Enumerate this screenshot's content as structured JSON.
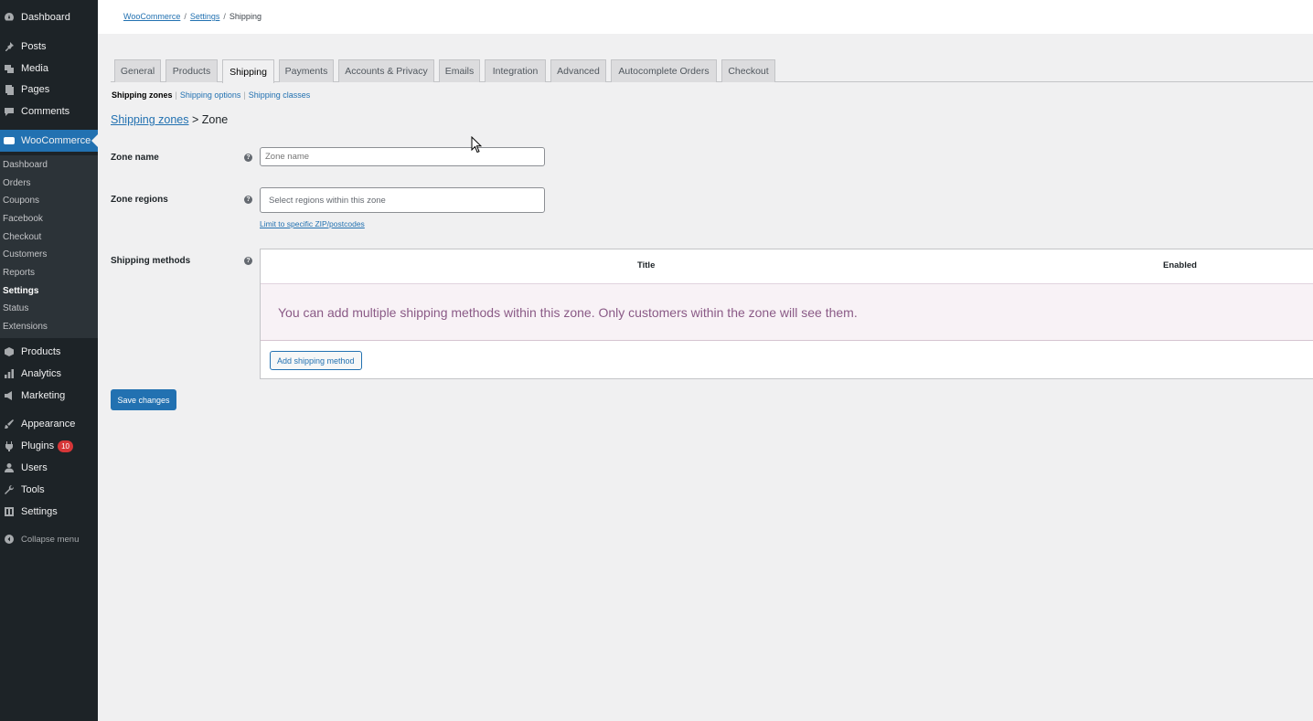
{
  "sidebar": {
    "items": [
      {
        "label": "Dashboard",
        "icon": "dashboard-icon"
      },
      {
        "label": "Posts",
        "icon": "pin-icon"
      },
      {
        "label": "Media",
        "icon": "media-icon"
      },
      {
        "label": "Pages",
        "icon": "pages-icon"
      },
      {
        "label": "Comments",
        "icon": "comment-icon"
      },
      {
        "label": "WooCommerce",
        "icon": "woo-icon"
      },
      {
        "label": "Products",
        "icon": "box-icon"
      },
      {
        "label": "Analytics",
        "icon": "bar-chart-icon"
      },
      {
        "label": "Marketing",
        "icon": "megaphone-icon"
      },
      {
        "label": "Appearance",
        "icon": "brush-icon"
      },
      {
        "label": "Plugins",
        "icon": "plug-icon",
        "badge": "10"
      },
      {
        "label": "Users",
        "icon": "user-icon"
      },
      {
        "label": "Tools",
        "icon": "wrench-icon"
      },
      {
        "label": "Settings",
        "icon": "settings-icon"
      }
    ],
    "submenu": [
      "Dashboard",
      "Orders",
      "Coupons",
      "Facebook",
      "Checkout",
      "Customers",
      "Reports",
      "Settings",
      "Status",
      "Extensions"
    ],
    "collapse_label": "Collapse menu"
  },
  "breadcrumb": {
    "items": [
      "WooCommerce",
      "Settings",
      "Shipping"
    ]
  },
  "tabs": [
    "General",
    "Products",
    "Shipping",
    "Payments",
    "Accounts & Privacy",
    "Emails",
    "Integration",
    "Advanced",
    "Autocomplete Orders",
    "Checkout"
  ],
  "subnav": {
    "current": "Shipping zones",
    "links": [
      "Shipping options",
      "Shipping classes"
    ]
  },
  "heading": {
    "link": "Shipping zones",
    "sep": ">",
    "current": "Zone"
  },
  "form": {
    "zone_name_label": "Zone name",
    "zone_name_placeholder": "Zone name",
    "zone_regions_label": "Zone regions",
    "zone_regions_placeholder": "Select regions within this zone",
    "limit_link": "Limit to specific ZIP/postcodes",
    "shipping_methods_label": "Shipping methods"
  },
  "methods_table": {
    "col_title": "Title",
    "col_enabled": "Enabled",
    "blank_message": "You can add multiple shipping methods within this zone. Only customers within the zone will see them.",
    "add_button": "Add shipping method"
  },
  "save_button": "Save changes",
  "colors": {
    "accent": "#2271b1",
    "sidebar": "#1d2327",
    "notice_text": "#8a5a86",
    "notice_bg": "#f8f2f6"
  }
}
